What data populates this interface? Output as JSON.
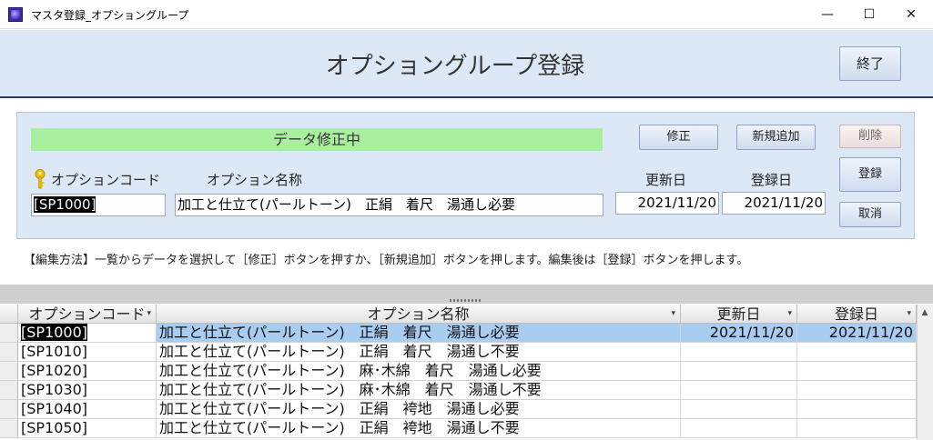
{
  "window": {
    "title": "マスタ登録_オプショングループ",
    "minimize_glyph": "—",
    "maximize_glyph": "☐",
    "close_glyph": "✕"
  },
  "header": {
    "title": "オプショングループ登録",
    "exit_label": "終了"
  },
  "form": {
    "status_text": "データ修正中",
    "buttons": {
      "edit": "修正",
      "add_new": "新規追加",
      "delete": "削除",
      "register": "登録",
      "cancel": "取消"
    },
    "labels": {
      "option_code": "オプションコード",
      "option_name": "オプション名称",
      "updated_date": "更新日",
      "registered_date": "登録日"
    },
    "values": {
      "option_code": "[SP1000]",
      "option_name": "加工と仕立て(パールトーン)　正絹　着尺　湯通し必要",
      "updated_date": "2021/11/20",
      "registered_date": "2021/11/20"
    },
    "instructions": "【編集方法】一覧からデータを選択して［修正］ボタンを押すか、［新規追加］ボタンを押します。編集後は［登録］ボタンを押します。"
  },
  "datasheet": {
    "columns": [
      "オプションコード",
      "オプション名称",
      "更新日",
      "登録日"
    ],
    "sort_arrow": "▾",
    "rows": [
      {
        "code": "[SP1000]",
        "name": "加工と仕立て(パールトーン)　正絹　着尺　湯通し必要",
        "updated": "2021/11/20",
        "registered": "2021/11/20"
      },
      {
        "code": "[SP1010]",
        "name": "加工と仕立て(パールトーン)　正絹　着尺　湯通し不要",
        "updated": "",
        "registered": ""
      },
      {
        "code": "[SP1020]",
        "name": "加工と仕立て(パールトーン)　麻･木綿　着尺　湯通し必要",
        "updated": "",
        "registered": ""
      },
      {
        "code": "[SP1030]",
        "name": "加工と仕立て(パールトーン)　麻･木綿　着尺　湯通し不要",
        "updated": "",
        "registered": ""
      },
      {
        "code": "[SP1040]",
        "name": "加工と仕立て(パールトーン)　正絹　袴地　湯通し必要",
        "updated": "",
        "registered": ""
      },
      {
        "code": "[SP1050]",
        "name": "加工と仕立て(パールトーン)　正絹　袴地　湯通し不要",
        "updated": "",
        "registered": ""
      }
    ]
  },
  "colors": {
    "header_band": "#dde8f7",
    "status_green": "#a8f0a0",
    "row_selected": "#a9cdf0"
  },
  "icons": {
    "key": "key-icon"
  }
}
